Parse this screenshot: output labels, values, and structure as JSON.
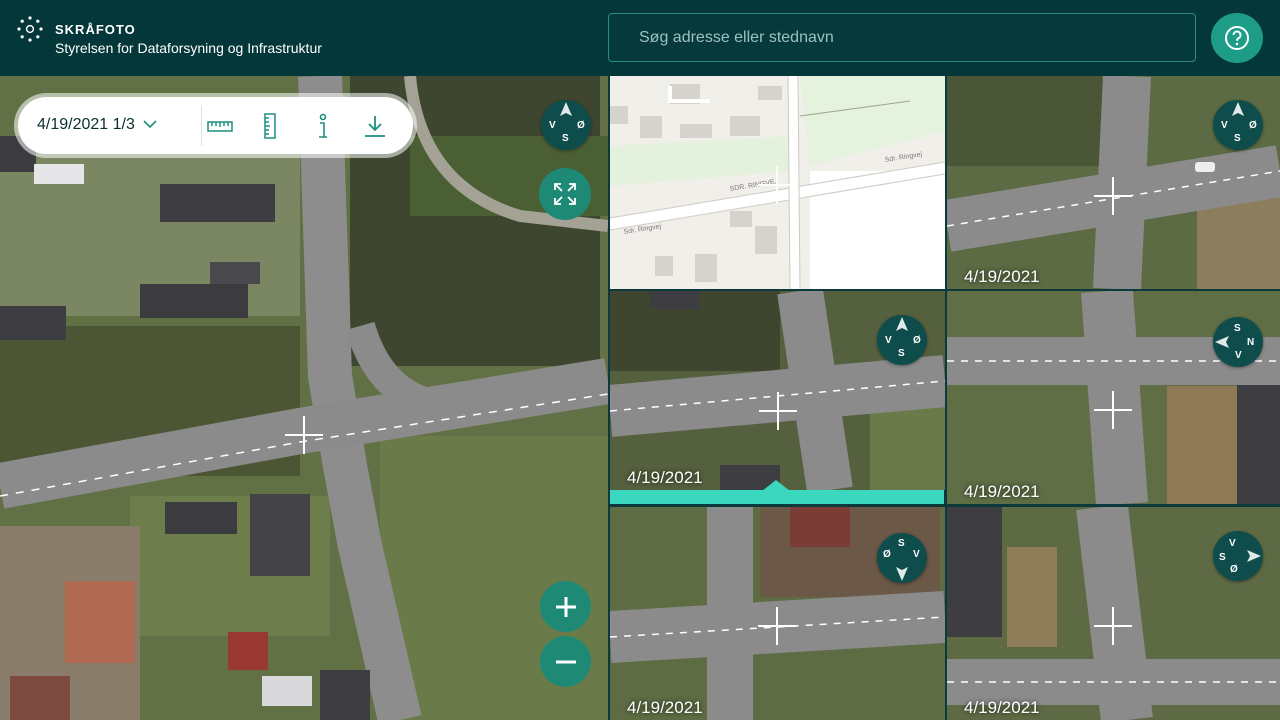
{
  "app": {
    "title": "SKRÅFOTO",
    "subtitle": "Styrelsen for Dataforsyning og Infrastruktur"
  },
  "search": {
    "placeholder": "Søg adresse eller stednavn"
  },
  "icons": {
    "logo": "logo-icon",
    "help": "help-icon",
    "ruler_horizontal": "ruler-horizontal-icon",
    "ruler_vertical": "ruler-vertical-icon",
    "info": "info-icon",
    "download": "download-icon",
    "expand": "expand-icon",
    "zoom_in": "plus-icon",
    "zoom_out": "minus-icon",
    "chevron": "chevron-down-icon"
  },
  "toolbar": {
    "date_selector": "4/19/2021 1/3"
  },
  "compass": {
    "north": "N",
    "west": "V",
    "east": "Ø",
    "south": "S"
  },
  "map_tile": {
    "road_label_1": "SDR. RINGVEJ",
    "road_label_2": "Sdr. Ringvej",
    "road_label_3": "Sdr. Ringvej"
  },
  "tiles": [
    {
      "date": "4/19/2021"
    },
    {
      "date": "4/19/2021"
    },
    {
      "date": "4/19/2021"
    },
    {
      "date": "4/19/2021"
    },
    {
      "date": "4/19/2021"
    }
  ],
  "colors": {
    "header_bg": "#04373a",
    "accent": "#1d9c88",
    "selected": "#3bd7bf"
  }
}
